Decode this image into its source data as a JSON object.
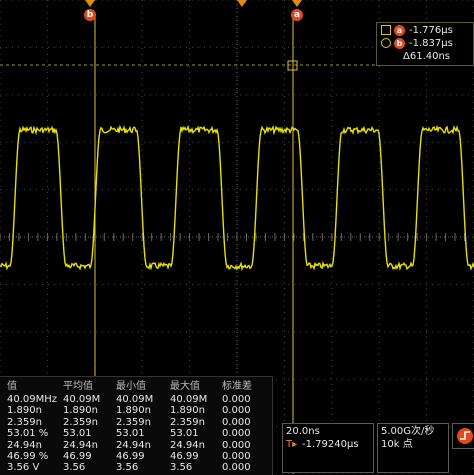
{
  "markers": {
    "a_label": "a",
    "b_label": "b"
  },
  "colors": {
    "waveform": "#e8e000",
    "cursor": "#d8c040",
    "marker_badge": "#e04a1c",
    "grid": "#4a4a4a",
    "dashed": "#9c9632"
  },
  "cursor_readout": {
    "a_value": "-1.776μs",
    "b_value": "-1.837μs",
    "delta_value": "Δ61.40ns"
  },
  "measurements": {
    "headers": [
      "值",
      "平均值",
      "最小值",
      "最大值",
      "标准差"
    ],
    "rows": [
      [
        "40.09MHz",
        "40.09M",
        "40.09M",
        "40.09M",
        "0.000"
      ],
      [
        "1.890n",
        "1.890n",
        "1.890n",
        "1.890n",
        "0.000"
      ],
      [
        "2.359n",
        "2.359n",
        "2.359n",
        "2.359n",
        "0.000"
      ],
      [
        "53.01 %",
        "53.01",
        "53.01",
        "53.01",
        "0.000"
      ],
      [
        "24.94n",
        "24.94n",
        "24.94n",
        "24.94n",
        "0.000"
      ],
      [
        "46.99 %",
        "46.99",
        "46.99",
        "46.99",
        "0.000"
      ],
      [
        "3.56 V",
        "3.56",
        "3.56",
        "3.56",
        "0.000"
      ]
    ]
  },
  "horizontal": {
    "time_per_div": "20.0ns",
    "position": "-1.79240μs"
  },
  "acquisition": {
    "sample_rate": "5.00G次/秒",
    "record_length": "10k 点"
  },
  "trigger": {
    "icon": "trigger-edge-icon"
  }
}
